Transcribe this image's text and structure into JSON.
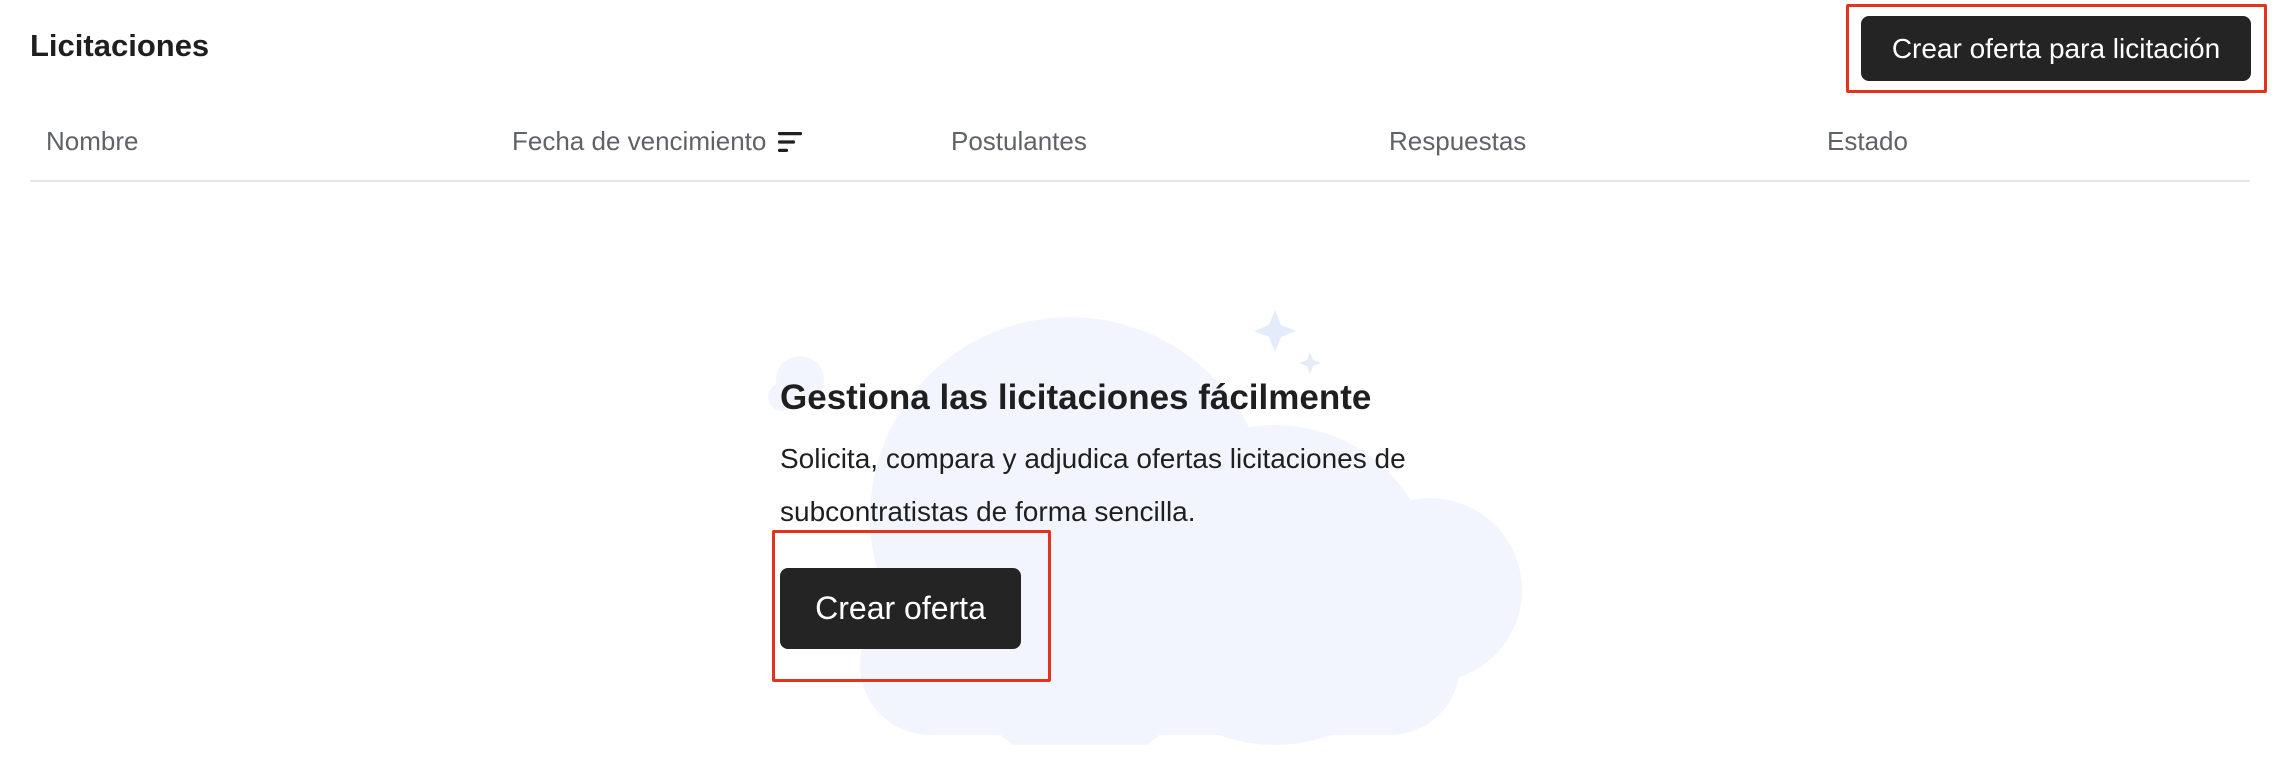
{
  "header": {
    "title": "Licitaciones",
    "create_button_label": "Crear oferta para licitación"
  },
  "table": {
    "columns": [
      {
        "label": "Nombre"
      },
      {
        "label": "Fecha de vencimiento",
        "icon": "sort-icon"
      },
      {
        "label": "Postulantes"
      },
      {
        "label": "Respuestas"
      },
      {
        "label": "Estado"
      }
    ]
  },
  "empty_state": {
    "title": "Gestiona las licitaciones fácilmente",
    "description": "Solicita, compara y adjudica ofertas licitaciones de subcontratistas de forma sencilla.",
    "button_label": "Crear oferta"
  },
  "colors": {
    "button_bg": "#242424",
    "highlight": "#e2341d",
    "illustration_bg": "#f2f5fd"
  }
}
